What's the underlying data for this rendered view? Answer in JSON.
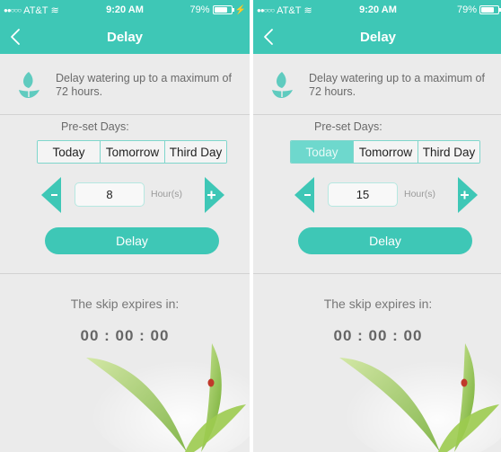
{
  "colors": {
    "accent": "#3ec7b6",
    "accent_light": "#6ed8cd",
    "background": "#ebebeb",
    "text_muted": "#6a6a6a"
  },
  "screens": [
    {
      "status": {
        "carrier": "AT&T",
        "signal_icon": "signal-dots-icon",
        "wifi_icon": "wifi-icon",
        "time": "9:20 AM",
        "battery_percent": "79%",
        "battery_level": 0.79,
        "charging": true
      },
      "nav": {
        "title": "Delay",
        "back_icon": "chevron-left-icon"
      },
      "description": "Delay watering up to a maximum of 72 hours.",
      "preset_label": "Pre-set Days:",
      "preset_options": [
        "Today",
        "Tomorrow",
        "Third Day"
      ],
      "preset_selected": "",
      "hours_value": "8",
      "hours_unit": "Hour(s)",
      "delay_label": "Delay",
      "skip_label": "The skip expires in:",
      "countdown": "00 : 00 : 00"
    },
    {
      "status": {
        "carrier": "AT&T",
        "signal_icon": "signal-dots-icon",
        "wifi_icon": "wifi-icon",
        "time": "9:20 AM",
        "battery_percent": "79%",
        "battery_level": 0.79,
        "charging": false
      },
      "nav": {
        "title": "Delay",
        "back_icon": "chevron-left-icon"
      },
      "description": "Delay watering up to a maximum of 72 hours.",
      "preset_label": "Pre-set Days:",
      "preset_options": [
        "Today",
        "Tomorrow",
        "Third Day"
      ],
      "preset_selected": "Today",
      "hours_value": "15",
      "hours_unit": "Hour(s)",
      "delay_label": "Delay",
      "skip_label": "The skip expires in:",
      "countdown": "00 : 00 : 00"
    }
  ]
}
